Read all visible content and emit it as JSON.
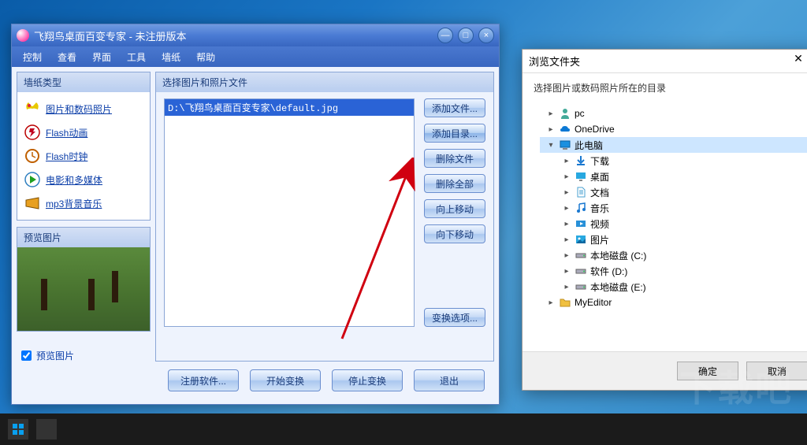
{
  "app": {
    "title": "飞翔鸟桌面百变专家 - 未注册版本"
  },
  "menu": {
    "items": [
      "控制",
      "查看",
      "界面",
      "工具",
      "墙纸",
      "帮助"
    ]
  },
  "categories": {
    "title": "墙纸类型",
    "items": [
      {
        "label": "图片和数码照片"
      },
      {
        "label": "Flash动画"
      },
      {
        "label": "Flash时钟"
      },
      {
        "label": "电影和多媒体"
      },
      {
        "label": "mp3背景音乐"
      }
    ]
  },
  "preview": {
    "title": "预览图片",
    "checkbox": "预览图片"
  },
  "select_panel": {
    "title": "选择图片和照片文件",
    "file": "D:\\飞翔鸟桌面百变专家\\default.jpg",
    "btns": {
      "add_file": "添加文件...",
      "add_dir": "添加目录...",
      "del_file": "删除文件",
      "del_all": "删除全部",
      "move_up": "向上移动",
      "move_down": "向下移动",
      "options": "变换选项..."
    }
  },
  "bottom": {
    "register": "注册软件...",
    "start": "开始变换",
    "stop": "停止变换",
    "exit": "退出"
  },
  "browse": {
    "title": "浏览文件夹",
    "subtitle": "选择图片或数码照片所在的目录",
    "nodes": {
      "pc": "pc",
      "onedrive": "OneDrive",
      "computer": "此电脑",
      "downloads": "下载",
      "desktop": "桌面",
      "documents": "文档",
      "music": "音乐",
      "videos": "视频",
      "pictures": "图片",
      "local_c": "本地磁盘 (C:)",
      "local_d": "软件 (D:)",
      "local_e": "本地磁盘 (E:)",
      "myeditor": "MyEditor"
    },
    "ok": "确定",
    "cancel": "取消"
  },
  "watermark": "下载吧"
}
